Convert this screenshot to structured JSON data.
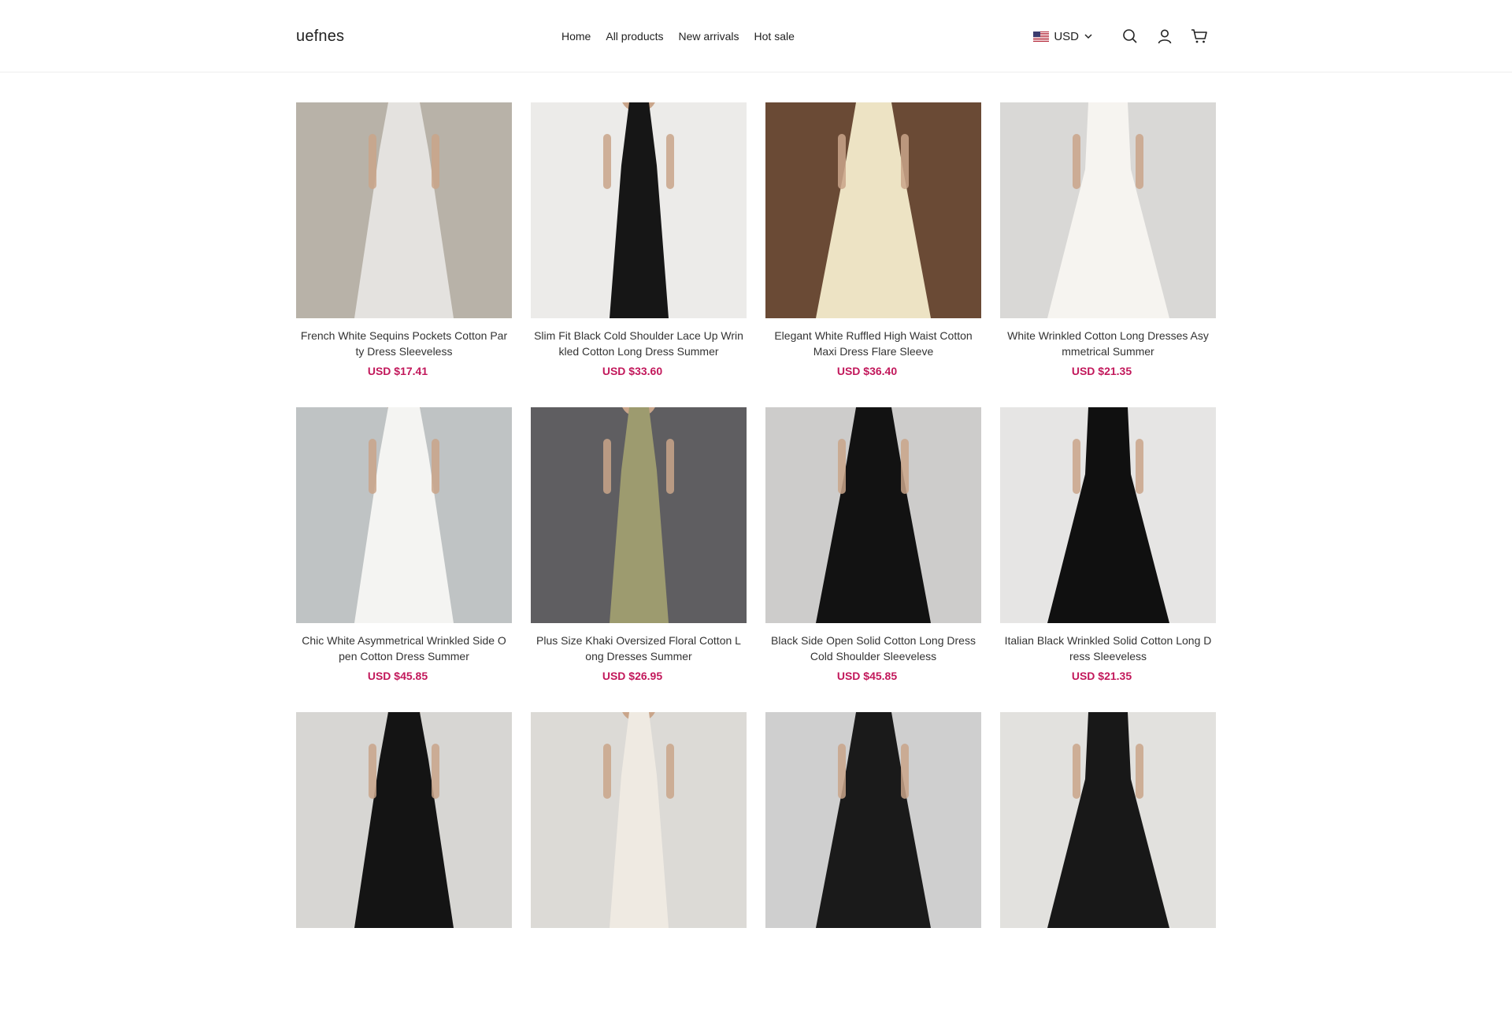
{
  "header": {
    "logo": "uefnes",
    "nav": [
      "Home",
      "All products",
      "New arrivals",
      "Hot sale"
    ],
    "currency": "USD",
    "icons": {
      "flag": "us-flag-icon",
      "currency_caret": "chevron-down-icon",
      "search": "search-icon",
      "account": "user-icon",
      "cart": "cart-icon"
    }
  },
  "products": [
    {
      "title": "French White Sequins Pockets Cotton Party Dress Sleeveless",
      "price": "USD $17.41",
      "colors": {
        "bg": "#b8b2a8",
        "dress": "#e4e2df"
      }
    },
    {
      "title": "Slim Fit Black Cold Shoulder Lace Up Wrinkled Cotton Long Dress Summer",
      "price": "USD $33.60",
      "colors": {
        "bg": "#ecebe9",
        "dress": "#161616"
      }
    },
    {
      "title": "Elegant White Ruffled High Waist Cotton Maxi Dress Flare Sleeve",
      "price": "USD $36.40",
      "colors": {
        "bg": "#6a4a35",
        "dress": "#ede3c4"
      }
    },
    {
      "title": "White Wrinkled Cotton Long Dresses Asymmetrical Summer",
      "price": "USD $21.35",
      "colors": {
        "bg": "#d9d8d6",
        "dress": "#f6f4f0"
      }
    },
    {
      "title": "Chic White Asymmetrical Wrinkled Side Open Cotton Dress Summer",
      "price": "USD $45.85",
      "colors": {
        "bg": "#bfc3c4",
        "dress": "#f4f4f2"
      }
    },
    {
      "title": "Plus Size Khaki Oversized Floral Cotton Long Dresses Summer",
      "price": "USD $26.95",
      "colors": {
        "bg": "#5f5e61",
        "dress": "#9d9b6f"
      }
    },
    {
      "title": "Black Side Open Solid Cotton Long Dress Cold Shoulder Sleeveless",
      "price": "USD $45.85",
      "colors": {
        "bg": "#cdcccb",
        "dress": "#121212"
      }
    },
    {
      "title": "Italian Black Wrinkled Solid Cotton Long Dress Sleeveless",
      "price": "USD $21.35",
      "colors": {
        "bg": "#e6e5e4",
        "dress": "#101010"
      }
    },
    {
      "title": "",
      "price": "",
      "colors": {
        "bg": "#d7d6d3",
        "dress": "#141414"
      }
    },
    {
      "title": "",
      "price": "",
      "colors": {
        "bg": "#dcdad6",
        "dress": "#efeae2"
      }
    },
    {
      "title": "",
      "price": "",
      "colors": {
        "bg": "#cfcfcf",
        "dress": "#1a1a1a"
      }
    },
    {
      "title": "",
      "price": "",
      "colors": {
        "bg": "#e2e1de",
        "dress": "#181818"
      }
    }
  ],
  "price_color": "#c2185b"
}
